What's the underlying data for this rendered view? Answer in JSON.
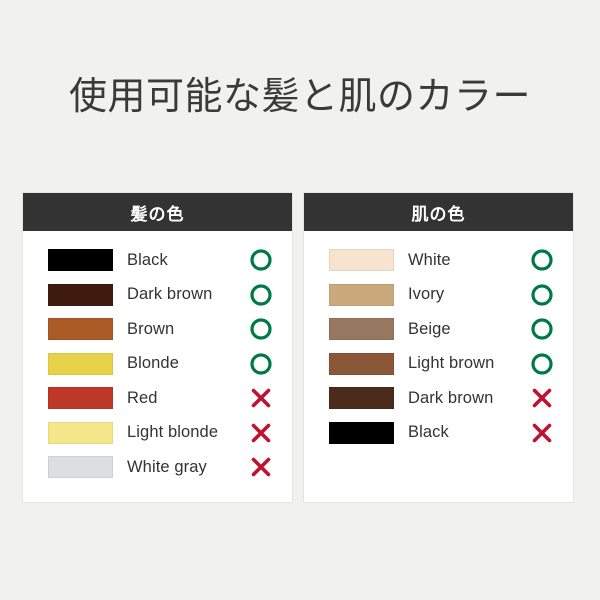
{
  "page": {
    "title": "使用可能な髪と肌のカラー",
    "background_color": "#f1f1f0",
    "title_color": "#3a3a3a"
  },
  "marks": {
    "ok_icon": "circle-ok-icon",
    "ng_icon": "cross-ng-icon",
    "ok_color": "#007a45",
    "ng_color": "#c2102f"
  },
  "tables": [
    {
      "id": "hair",
      "header": "髪の色",
      "header_bg": "#333333",
      "header_color": "#ffffff",
      "rows": [
        {
          "label": "Black",
          "color": "#000000",
          "status": "ok"
        },
        {
          "label": "Dark brown",
          "color": "#3e1a0f",
          "status": "ok"
        },
        {
          "label": "Brown",
          "color": "#aa5b26",
          "status": "ok"
        },
        {
          "label": "Blonde",
          "color": "#e8d24a",
          "status": "ok"
        },
        {
          "label": "Red",
          "color": "#bf3727",
          "status": "ng"
        },
        {
          "label": "Light blonde",
          "color": "#f5e88a",
          "status": "ng"
        },
        {
          "label": "White gray",
          "color": "#dcdee2",
          "status": "ng"
        }
      ]
    },
    {
      "id": "skin",
      "header": "肌の色",
      "header_bg": "#333333",
      "header_color": "#ffffff",
      "rows": [
        {
          "label": "White",
          "color": "#f7e3ce",
          "status": "ok"
        },
        {
          "label": "Ivory",
          "color": "#cba97c",
          "status": "ok"
        },
        {
          "label": "Beige",
          "color": "#96775f",
          "status": "ok"
        },
        {
          "label": "Light brown",
          "color": "#8a5739",
          "status": "ok"
        },
        {
          "label": "Dark brown",
          "color": "#4a2b1c",
          "status": "ng"
        },
        {
          "label": "Black",
          "color": "#000000",
          "status": "ng"
        }
      ]
    }
  ]
}
